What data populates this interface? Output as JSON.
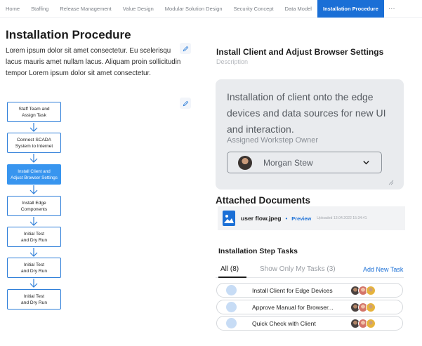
{
  "nav": {
    "tabs": [
      {
        "label": "Home"
      },
      {
        "label": "Staffing"
      },
      {
        "label": "Release Management"
      },
      {
        "label": "Value Design"
      },
      {
        "label": "Modular Solution Design"
      },
      {
        "label": "Security Concept"
      },
      {
        "label": "Data Model"
      },
      {
        "label": "Installation Procedure"
      }
    ],
    "active_tab": "Installation Procedure",
    "more_label": "···"
  },
  "left": {
    "title": "Installation Procedure",
    "intro_lines": [
      "Lorem ipsum dolor sit amet consectetur. Eu scelerisqu",
      "lacus mauris amet nullam lacus. Aliquam proin sollicitudin",
      "tempor Lorem ipsum dolor sit amet consectetur."
    ],
    "flow_steps": [
      {
        "line1": "Staff Team and",
        "line2": "Assign Task",
        "active": false
      },
      {
        "line1": "Connect SCADA",
        "line2": "System to Internet",
        "active": false
      },
      {
        "line1": "Install Client and",
        "line2": "Adjust Browser Settings",
        "active": true
      },
      {
        "line1": "Install Edge",
        "line2": "Components",
        "active": false
      },
      {
        "line1": "Initial Test",
        "line2": "and Dry Run",
        "active": false
      },
      {
        "line1": "Initial Test",
        "line2": "and Dry Run",
        "active": false
      },
      {
        "line1": "Initial Test",
        "line2": "and Dry Run",
        "active": false
      }
    ]
  },
  "detail": {
    "title": "Install Client and Adjust Browser Settings",
    "description_label": "Description",
    "description_lines": [
      "Installation of client onto the edge",
      "devices and data sources for new UI",
      "and interaction."
    ],
    "owner_label": "Assigned Workstep Owner",
    "owner_name": "Morgan Stew",
    "attachments_title": "Attached Documents",
    "attachment": {
      "file_name": "user flow.jpeg",
      "separator": "•",
      "preview_label": "Preview",
      "uploaded": "Uploaded 13.04.2022 15:34:41"
    },
    "tasks_title": "Installation Step Tasks",
    "filter_all": "All (8)",
    "filter_mine": "Show Only My Tasks (3)",
    "add_task": "Add New Task",
    "tasks": [
      {
        "label": "Install Client for Edge Devices"
      },
      {
        "label": "Approve Manual for Browser..."
      },
      {
        "label": "Quick Check with Client"
      }
    ]
  },
  "colors": {
    "accent": "#1a6fd6",
    "flow_border": "#2f7fd9",
    "flow_active": "#3895ef",
    "card_bg": "#e9ebee"
  }
}
